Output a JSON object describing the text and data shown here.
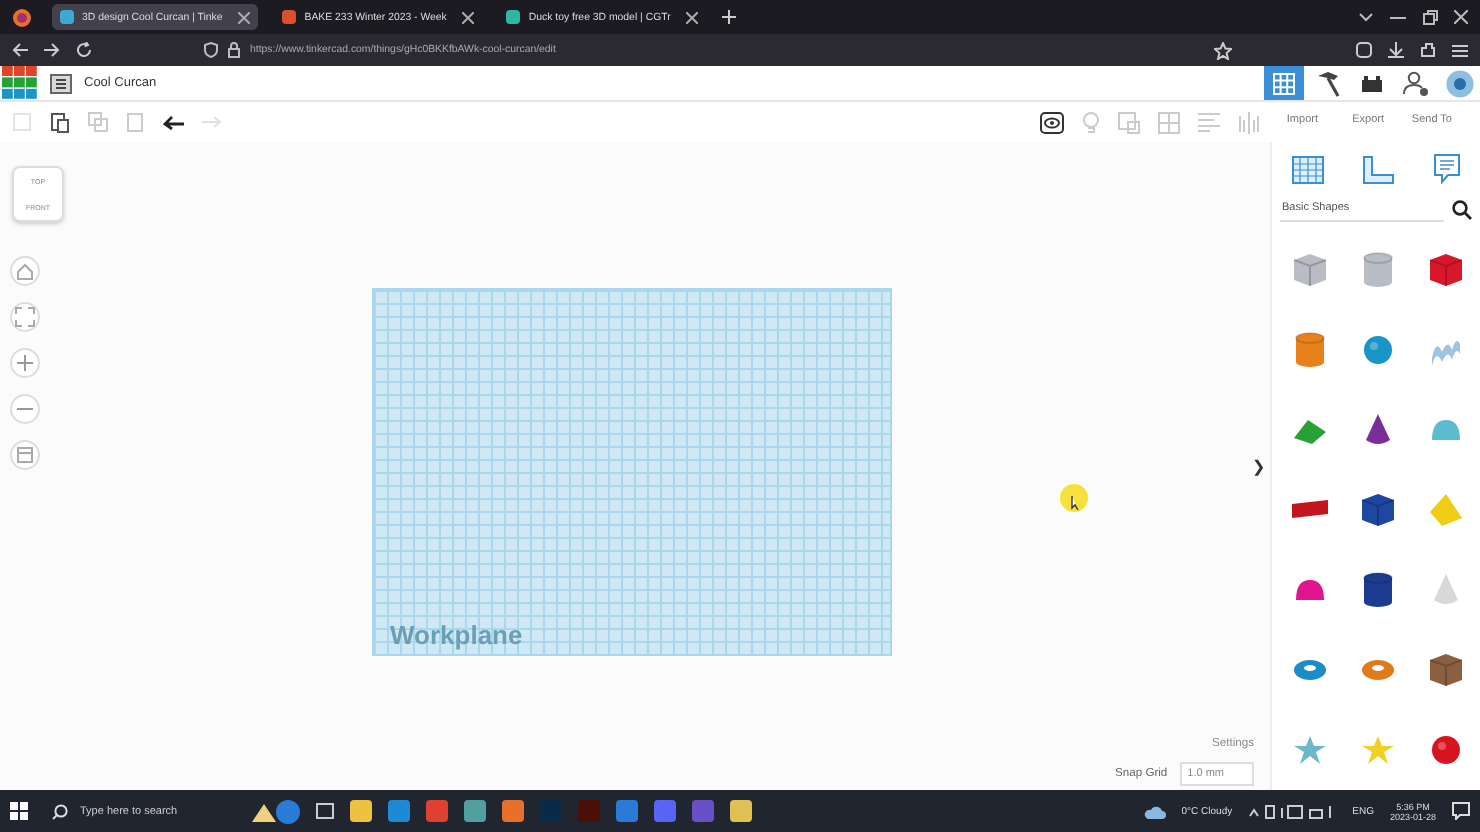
{
  "browser": {
    "tabs": [
      {
        "title": "3D design Cool Curcan | Tinke",
        "selected": true,
        "color": "#3fa9d6"
      },
      {
        "title": "BAKE 233 Winter 2023 - Week",
        "selected": false,
        "color": "#d9502b"
      },
      {
        "title": "Duck toy free 3D model | CGTr",
        "selected": false,
        "color": "#2fb5a0"
      }
    ],
    "url": "https://www.tinkercad.com/things/gHc0BKKfbAWk-cool-curcan/edit"
  },
  "app": {
    "title": "Cool Curcan",
    "header_tools": [
      {
        "kind": "grid",
        "selected": true
      },
      {
        "kind": "hammer",
        "selected": false
      },
      {
        "kind": "bricks",
        "selected": false
      },
      {
        "kind": "user",
        "selected": false
      },
      {
        "kind": "avatar",
        "selected": false
      }
    ],
    "actions": [
      "Import",
      "Export",
      "Send To"
    ]
  },
  "view_cube": {
    "top": "TOP",
    "front": "FRONT"
  },
  "workplane": {
    "label": "Workplane"
  },
  "settings": "Settings",
  "snap_grid": {
    "label": "Snap Grid",
    "value": "1.0 mm"
  },
  "panel_toggle": "❯",
  "library": {
    "category": "Basic Shapes",
    "shapes": [
      {
        "kind": "box",
        "color": "#b8bcc4"
      },
      {
        "kind": "cylinder",
        "color": "#b8bcc4"
      },
      {
        "kind": "box",
        "color": "#d8182a"
      },
      {
        "kind": "cylinder",
        "color": "#e8801c"
      },
      {
        "kind": "sphere",
        "color": "#1a95c8"
      },
      {
        "kind": "wave",
        "color": "#9fc4e0"
      },
      {
        "kind": "wedge",
        "color": "#27a035"
      },
      {
        "kind": "cone",
        "color": "#7b2d9a"
      },
      {
        "kind": "dome",
        "color": "#5bbcd0"
      },
      {
        "kind": "text",
        "color": "#c4141e"
      },
      {
        "kind": "box",
        "color": "#1d47a0"
      },
      {
        "kind": "pyramid",
        "color": "#f0cc14"
      },
      {
        "kind": "dome",
        "color": "#e0148c"
      },
      {
        "kind": "cylinder",
        "color": "#1d3c90"
      },
      {
        "kind": "cone",
        "color": "#d8d8d8"
      },
      {
        "kind": "torus",
        "color": "#1a8cc8"
      },
      {
        "kind": "torus",
        "color": "#e07b1c"
      },
      {
        "kind": "box",
        "color": "#8a6040"
      },
      {
        "kind": "star",
        "color": "#6cb8c8"
      },
      {
        "kind": "star",
        "color": "#f0d020"
      },
      {
        "kind": "sphere",
        "color": "#d81420"
      }
    ]
  },
  "taskbar": {
    "search_placeholder": "Type here to search",
    "weather": "0°C  Cloudy",
    "language": "ENG",
    "time": "5:36 PM",
    "date": "2023-01-28"
  }
}
